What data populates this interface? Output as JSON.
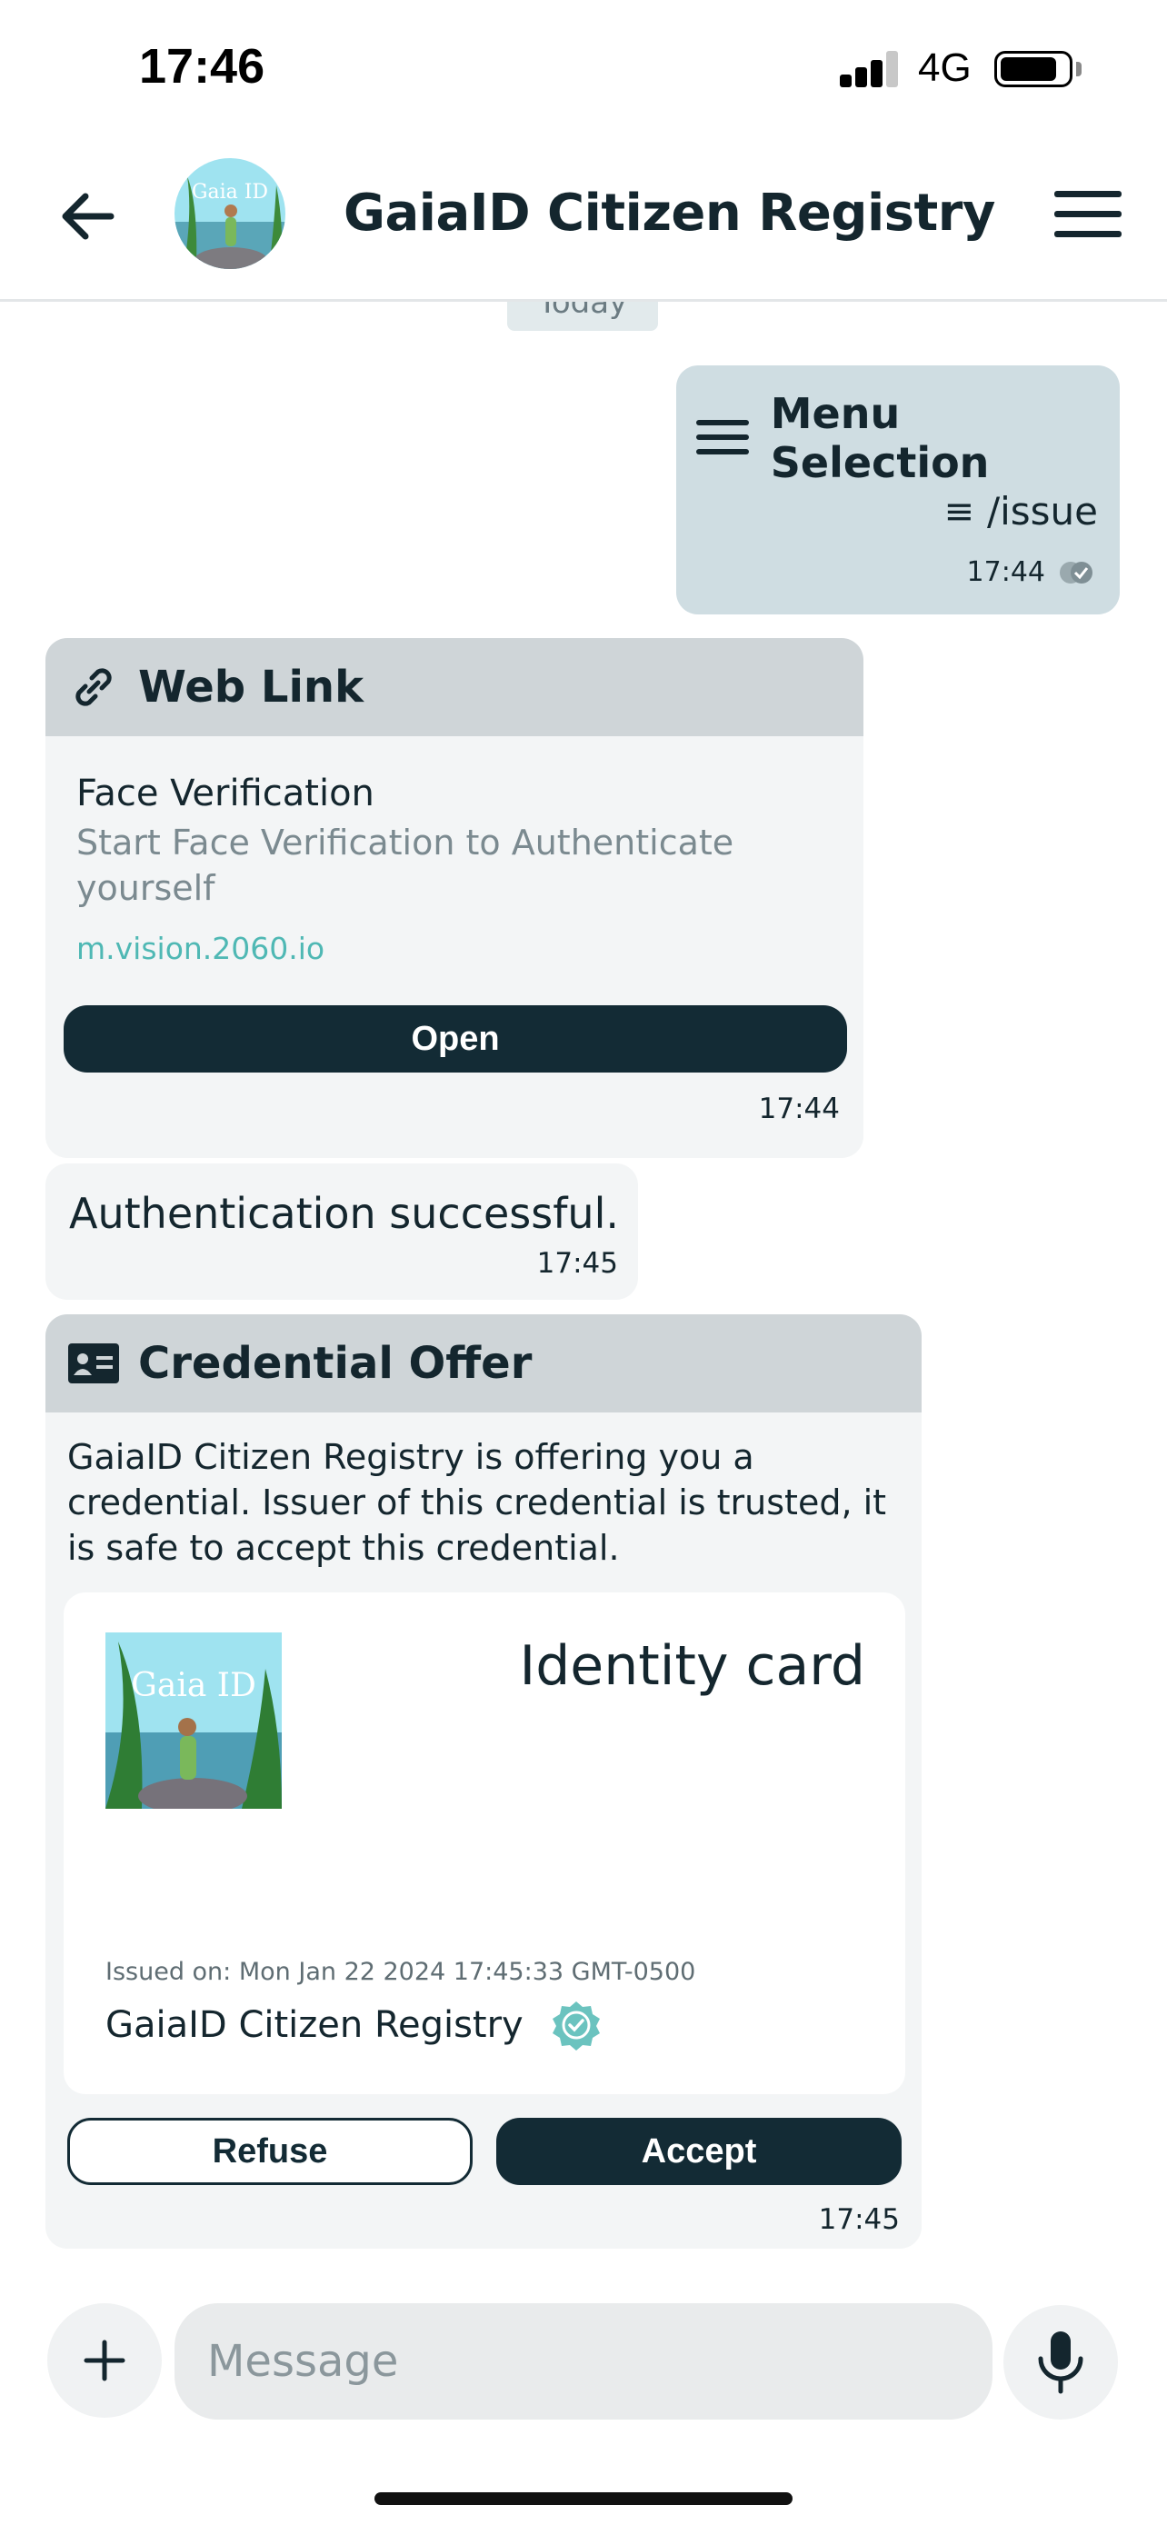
{
  "status_bar": {
    "time": "17:46",
    "network": "4G",
    "battery_level": 0.85
  },
  "header": {
    "title": "GaiaID Citizen Registry",
    "avatar_text": "Gaia ID"
  },
  "chat": {
    "day_label": "Today",
    "outgoing": {
      "title": "Menu Selection",
      "command": "/issue",
      "time": "17:44"
    },
    "weblink": {
      "header": "Web Link",
      "title": "Face Verification",
      "description": "Start Face Verification to Authenticate yourself",
      "domain": "m.vision.2060.io",
      "button": "Open",
      "time": "17:44"
    },
    "text_message": {
      "text": "Authentication successful.",
      "time": "17:45"
    },
    "credential_offer": {
      "header": "Credential Offer",
      "body": "GaiaID Citizen Registry is offering you a credential. Issuer of this credential is trusted, it is safe to accept this credential.",
      "card_title": "Identity card",
      "card_image_text": "Gaia ID",
      "issued_on": "Issued on: Mon Jan 22 2024 17:45:33 GMT-0500",
      "issuer": "GaiaID Citizen Registry",
      "refuse_label": "Refuse",
      "accept_label": "Accept",
      "time": "17:45"
    }
  },
  "composer": {
    "placeholder": "Message"
  },
  "colors": {
    "primary": "#132b35",
    "bubble_out": "#cfdde2",
    "card_bg": "#f3f5f6",
    "card_head": "#cfd5d8",
    "link": "#4fb8b4"
  }
}
